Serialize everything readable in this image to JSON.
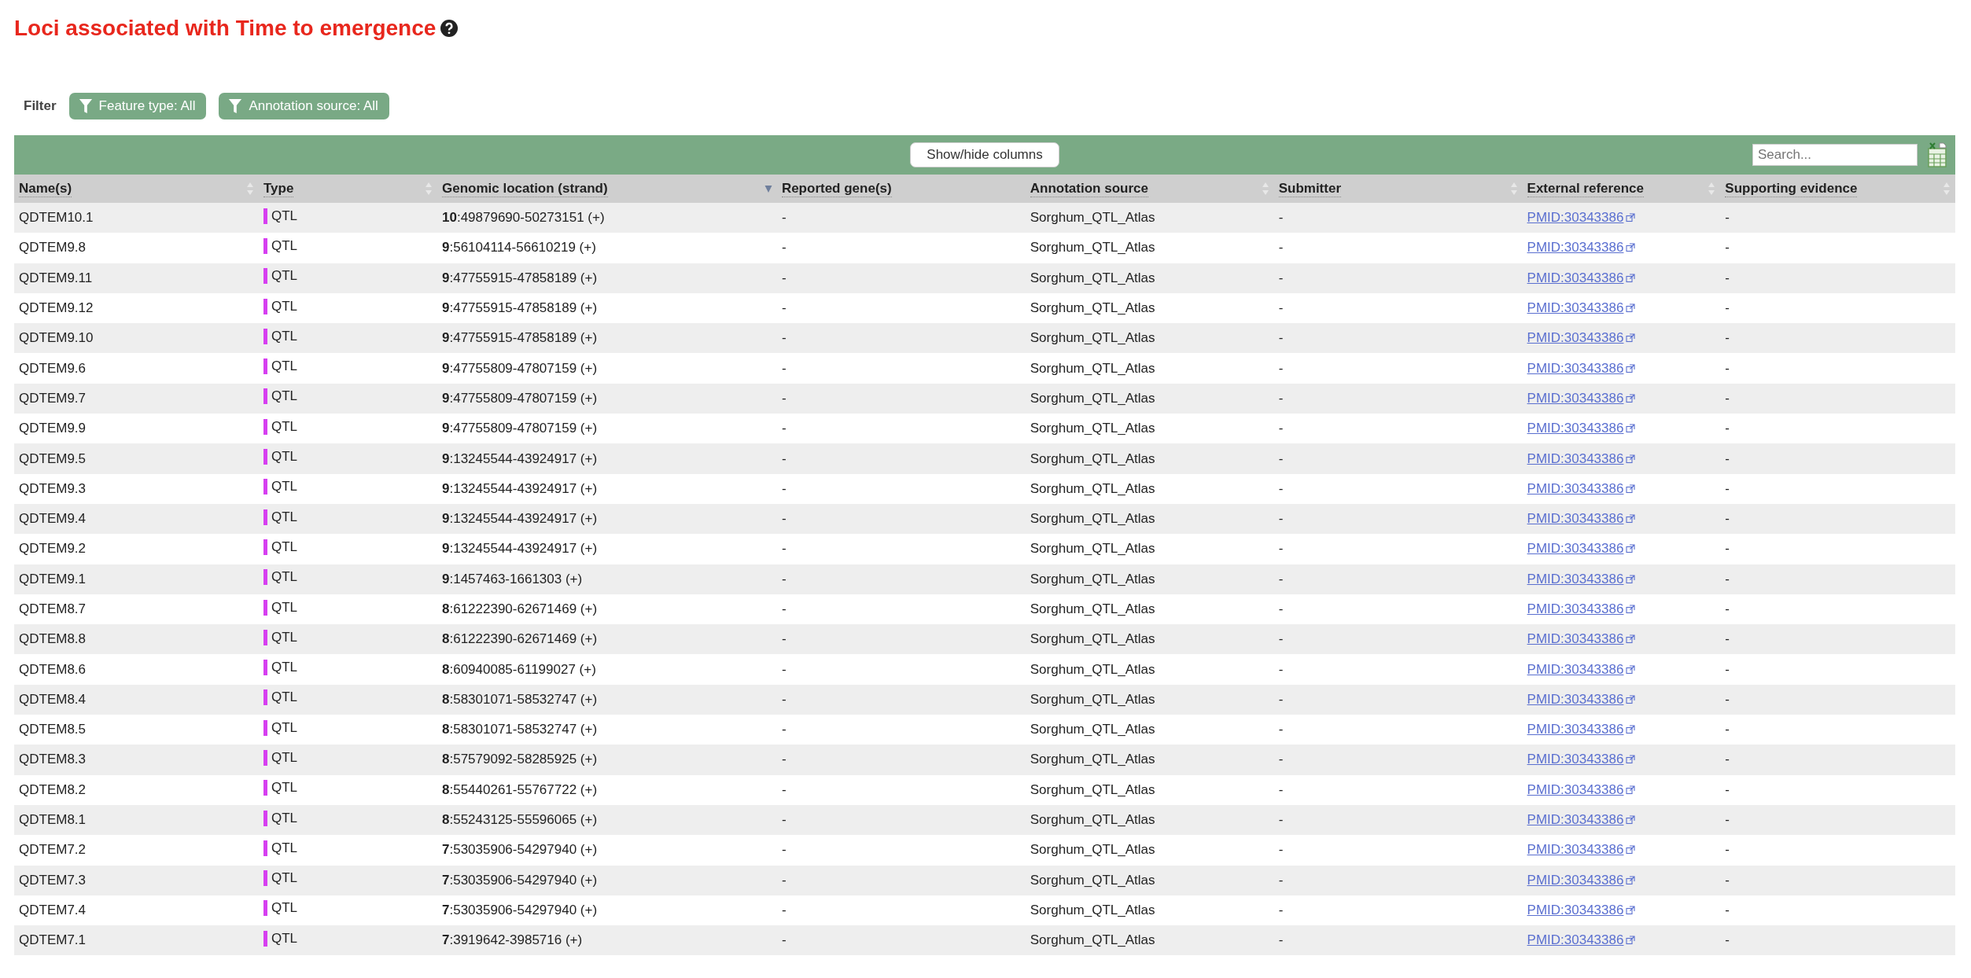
{
  "title": "Loci associated with Time to emergence",
  "filter": {
    "label": "Filter",
    "buttons": [
      "Feature type: All",
      "Annotation source: All"
    ]
  },
  "toolbar": {
    "columns_button": "Show/hide columns",
    "search": {
      "placeholder": "Search..."
    }
  },
  "table": {
    "columns": [
      {
        "label": "Name(s)",
        "sortable": true,
        "sorted": false
      },
      {
        "label": "Type",
        "sortable": true,
        "sorted": false
      },
      {
        "label": "Genomic location (strand)",
        "sortable": true,
        "sorted": true
      },
      {
        "label": "Reported gene(s)",
        "sortable": false
      },
      {
        "label": "Annotation source",
        "sortable": true,
        "sorted": false
      },
      {
        "label": "Submitter",
        "sortable": true,
        "sorted": false
      },
      {
        "label": "External reference",
        "sortable": true,
        "sorted": false
      },
      {
        "label": "Supporting evidence",
        "sortable": true,
        "sorted": false
      }
    ],
    "rows": [
      {
        "name": "QDTEM10.1",
        "type": "QTL",
        "color": "#d63ff0",
        "location": "**10**:49879690-50273151 (+)",
        "reported": "-",
        "source": "Sorghum_QTL_Atlas",
        "submitter": "-",
        "reference": "PMID:30343386",
        "evidence": "-"
      },
      {
        "name": "QDTEM9.8",
        "type": "QTL",
        "color": "#d63ff0",
        "location": "**9**:56104114-56610219 (+)",
        "reported": "-",
        "source": "Sorghum_QTL_Atlas",
        "submitter": "-",
        "reference": "PMID:30343386",
        "evidence": "-"
      },
      {
        "name": "QDTEM9.11",
        "type": "QTL",
        "color": "#d63ff0",
        "location": "**9**:47755915-47858189 (+)",
        "reported": "-",
        "source": "Sorghum_QTL_Atlas",
        "submitter": "-",
        "reference": "PMID:30343386",
        "evidence": "-"
      },
      {
        "name": "QDTEM9.12",
        "type": "QTL",
        "color": "#d63ff0",
        "location": "**9**:47755915-47858189 (+)",
        "reported": "-",
        "source": "Sorghum_QTL_Atlas",
        "submitter": "-",
        "reference": "PMID:30343386",
        "evidence": "-"
      },
      {
        "name": "QDTEM9.10",
        "type": "QTL",
        "color": "#d63ff0",
        "location": "**9**:47755915-47858189 (+)",
        "reported": "-",
        "source": "Sorghum_QTL_Atlas",
        "submitter": "-",
        "reference": "PMID:30343386",
        "evidence": "-"
      },
      {
        "name": "QDTEM9.6",
        "type": "QTL",
        "color": "#d63ff0",
        "location": "**9**:47755809-47807159 (+)",
        "reported": "-",
        "source": "Sorghum_QTL_Atlas",
        "submitter": "-",
        "reference": "PMID:30343386",
        "evidence": "-"
      },
      {
        "name": "QDTEM9.7",
        "type": "QTL",
        "color": "#d63ff0",
        "location": "**9**:47755809-47807159 (+)",
        "reported": "-",
        "source": "Sorghum_QTL_Atlas",
        "submitter": "-",
        "reference": "PMID:30343386",
        "evidence": "-"
      },
      {
        "name": "QDTEM9.9",
        "type": "QTL",
        "color": "#d63ff0",
        "location": "**9**:47755809-47807159 (+)",
        "reported": "-",
        "source": "Sorghum_QTL_Atlas",
        "submitter": "-",
        "reference": "PMID:30343386",
        "evidence": "-"
      },
      {
        "name": "QDTEM9.5",
        "type": "QTL",
        "color": "#d63ff0",
        "location": "**9**:13245544-43924917 (+)",
        "reported": "-",
        "source": "Sorghum_QTL_Atlas",
        "submitter": "-",
        "reference": "PMID:30343386",
        "evidence": "-"
      },
      {
        "name": "QDTEM9.3",
        "type": "QTL",
        "color": "#d63ff0",
        "location": "**9**:13245544-43924917 (+)",
        "reported": "-",
        "source": "Sorghum_QTL_Atlas",
        "submitter": "-",
        "reference": "PMID:30343386",
        "evidence": "-"
      },
      {
        "name": "QDTEM9.4",
        "type": "QTL",
        "color": "#d63ff0",
        "location": "**9**:13245544-43924917 (+)",
        "reported": "-",
        "source": "Sorghum_QTL_Atlas",
        "submitter": "-",
        "reference": "PMID:30343386",
        "evidence": "-"
      },
      {
        "name": "QDTEM9.2",
        "type": "QTL",
        "color": "#d63ff0",
        "location": "**9**:13245544-43924917 (+)",
        "reported": "-",
        "source": "Sorghum_QTL_Atlas",
        "submitter": "-",
        "reference": "PMID:30343386",
        "evidence": "-"
      },
      {
        "name": "QDTEM9.1",
        "type": "QTL",
        "color": "#d63ff0",
        "location": "**9**:1457463-1661303 (+)",
        "reported": "-",
        "source": "Sorghum_QTL_Atlas",
        "submitter": "-",
        "reference": "PMID:30343386",
        "evidence": "-"
      },
      {
        "name": "QDTEM8.7",
        "type": "QTL",
        "color": "#d63ff0",
        "location": "**8**:61222390-62671469 (+)",
        "reported": "-",
        "source": "Sorghum_QTL_Atlas",
        "submitter": "-",
        "reference": "PMID:30343386",
        "evidence": "-"
      },
      {
        "name": "QDTEM8.8",
        "type": "QTL",
        "color": "#d63ff0",
        "location": "**8**:61222390-62671469 (+)",
        "reported": "-",
        "source": "Sorghum_QTL_Atlas",
        "submitter": "-",
        "reference": "PMID:30343386",
        "evidence": "-"
      },
      {
        "name": "QDTEM8.6",
        "type": "QTL",
        "color": "#d63ff0",
        "location": "**8**:60940085-61199027 (+)",
        "reported": "-",
        "source": "Sorghum_QTL_Atlas",
        "submitter": "-",
        "reference": "PMID:30343386",
        "evidence": "-"
      },
      {
        "name": "QDTEM8.4",
        "type": "QTL",
        "color": "#d63ff0",
        "location": "**8**:58301071-58532747 (+)",
        "reported": "-",
        "source": "Sorghum_QTL_Atlas",
        "submitter": "-",
        "reference": "PMID:30343386",
        "evidence": "-"
      },
      {
        "name": "QDTEM8.5",
        "type": "QTL",
        "color": "#d63ff0",
        "location": "**8**:58301071-58532747 (+)",
        "reported": "-",
        "source": "Sorghum_QTL_Atlas",
        "submitter": "-",
        "reference": "PMID:30343386",
        "evidence": "-"
      },
      {
        "name": "QDTEM8.3",
        "type": "QTL",
        "color": "#d63ff0",
        "location": "**8**:57579092-58285925 (+)",
        "reported": "-",
        "source": "Sorghum_QTL_Atlas",
        "submitter": "-",
        "reference": "PMID:30343386",
        "evidence": "-"
      },
      {
        "name": "QDTEM8.2",
        "type": "QTL",
        "color": "#d63ff0",
        "location": "**8**:55440261-55767722 (+)",
        "reported": "-",
        "source": "Sorghum_QTL_Atlas",
        "submitter": "-",
        "reference": "PMID:30343386",
        "evidence": "-"
      },
      {
        "name": "QDTEM8.1",
        "type": "QTL",
        "color": "#d63ff0",
        "location": "**8**:55243125-55596065 (+)",
        "reported": "-",
        "source": "Sorghum_QTL_Atlas",
        "submitter": "-",
        "reference": "PMID:30343386",
        "evidence": "-"
      },
      {
        "name": "QDTEM7.2",
        "type": "QTL",
        "color": "#d63ff0",
        "location": "**7**:53035906-54297940 (+)",
        "reported": "-",
        "source": "Sorghum_QTL_Atlas",
        "submitter": "-",
        "reference": "PMID:30343386",
        "evidence": "-"
      },
      {
        "name": "QDTEM7.3",
        "type": "QTL",
        "color": "#d63ff0",
        "location": "**7**:53035906-54297940 (+)",
        "reported": "-",
        "source": "Sorghum_QTL_Atlas",
        "submitter": "-",
        "reference": "PMID:30343386",
        "evidence": "-"
      },
      {
        "name": "QDTEM7.4",
        "type": "QTL",
        "color": "#d63ff0",
        "location": "**7**:53035906-54297940 (+)",
        "reported": "-",
        "source": "Sorghum_QTL_Atlas",
        "submitter": "-",
        "reference": "PMID:30343386",
        "evidence": "-"
      },
      {
        "name": "QDTEM7.1",
        "type": "QTL",
        "color": "#d63ff0",
        "location": "**7**:3919642-3985716 (+)",
        "reported": "-",
        "source": "Sorghum_QTL_Atlas",
        "submitter": "-",
        "reference": "PMID:30343386",
        "evidence": "-"
      }
    ]
  }
}
